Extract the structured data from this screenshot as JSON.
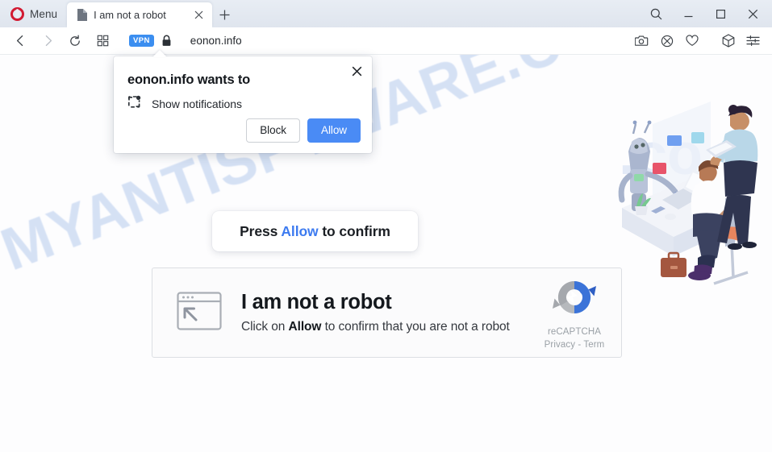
{
  "browser": {
    "name": "Opera",
    "menu_label": "Menu",
    "brand_color": "#d21a32",
    "titlebar": {
      "icons": [
        {
          "name": "search-icon",
          "label": "Search"
        },
        {
          "name": "minimize-icon",
          "label": "Minimize"
        },
        {
          "name": "maximize-icon",
          "label": "Maximize"
        },
        {
          "name": "close-window-icon",
          "label": "Close"
        }
      ]
    },
    "tabs": [
      {
        "title": "I am not a robot",
        "favicon": "page-document-icon",
        "active": true
      }
    ],
    "new_tab_label": "+",
    "toolbar": {
      "back_label": "Back",
      "forward_label": "Forward",
      "reload_label": "Reload",
      "speeddial_label": "Speed Dial",
      "vpn_badge": "VPN",
      "vpn_badge_color": "#3b8ef0",
      "lock_icon": "padlock-icon",
      "address": "eonon.info",
      "right_icons": [
        {
          "name": "snapshot-camera-icon",
          "label": "Snapshot"
        },
        {
          "name": "ad-blocker-shield-icon",
          "label": "Ad blocker"
        },
        {
          "name": "heart-favorite-icon",
          "label": "Add to favorites"
        },
        {
          "name": "pods-cube-icon",
          "label": "Pods"
        },
        {
          "name": "easy-setup-sliders-icon",
          "label": "Easy setup"
        }
      ]
    }
  },
  "notification_dialog": {
    "title": "eonon.info wants to",
    "permission_icon": "notification-bell-icon",
    "permission_label": "Show notifications",
    "close_label": "×",
    "block_label": "Block",
    "allow_label": "Allow",
    "allow_color": "#4a8bf5"
  },
  "page": {
    "watermark": "MYANTISPYWARE.COM",
    "banner": {
      "text_before": "Press ",
      "highlight": "Allow",
      "text_after": " to confirm",
      "highlight_color": "#3d7bf0"
    },
    "robot_card": {
      "window_cursor_icon": "browser-window-cursor-icon",
      "title": "I am not a robot",
      "subtitle_before": "Click on ",
      "subtitle_bold": "Allow",
      "subtitle_after": " to confirm that you are not a robot",
      "recaptcha_logo": "recaptcha-logo-icon",
      "recaptcha_label": "reCAPTCHA",
      "recaptcha_links": "Privacy - Term"
    },
    "illustration": {
      "name": "office-robot-workers-illustration",
      "alt": "Isometric illustration: robot, man at desk with laptop, woman with tablet"
    }
  }
}
